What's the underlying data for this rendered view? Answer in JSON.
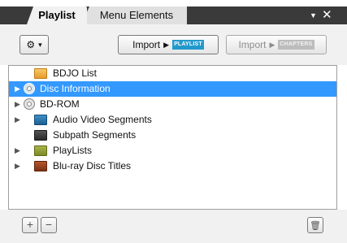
{
  "tabs": {
    "active_label": "Playlist",
    "inactive_label": "Menu Elements",
    "menu_glyph": "▼",
    "close_glyph": "✕"
  },
  "toolbar": {
    "gear_glyph": "⚙",
    "gear_caret": "▾",
    "import_playlist": {
      "label": "Import",
      "arrow": "▶",
      "tag": "PLAYLIST",
      "enabled": true
    },
    "import_chapters": {
      "label": "Import",
      "arrow": "▶",
      "tag": "CHAPTERS",
      "enabled": false
    }
  },
  "tree": {
    "items": [
      {
        "label": "BDJO List",
        "icon": "folder-orange-icon",
        "expandable": false,
        "selected": false
      },
      {
        "label": "Disc Information",
        "icon": "disc-info-icon",
        "expandable": true,
        "selected": true
      },
      {
        "label": "BD-ROM",
        "icon": "disc-icon",
        "expandable": true,
        "selected": false
      },
      {
        "label": "Audio Video Segments",
        "icon": "folder-blue-icon",
        "expandable": true,
        "selected": false
      },
      {
        "label": "Subpath Segments",
        "icon": "folder-dark-icon",
        "expandable": false,
        "selected": false
      },
      {
        "label": "PlayLists",
        "icon": "folder-olive-icon",
        "expandable": true,
        "selected": false
      },
      {
        "label": "Blu-ray Disc Titles",
        "icon": "folder-brown-icon",
        "expandable": true,
        "selected": false
      }
    ],
    "expand_glyph": "▶"
  },
  "bottom": {
    "add_glyph": "+",
    "remove_glyph": "−",
    "trash_glyph": "🗑"
  },
  "colors": {
    "selection": "#3399ff",
    "tabstrip": "#3a3a3a",
    "tag_active": "#2299cc"
  }
}
